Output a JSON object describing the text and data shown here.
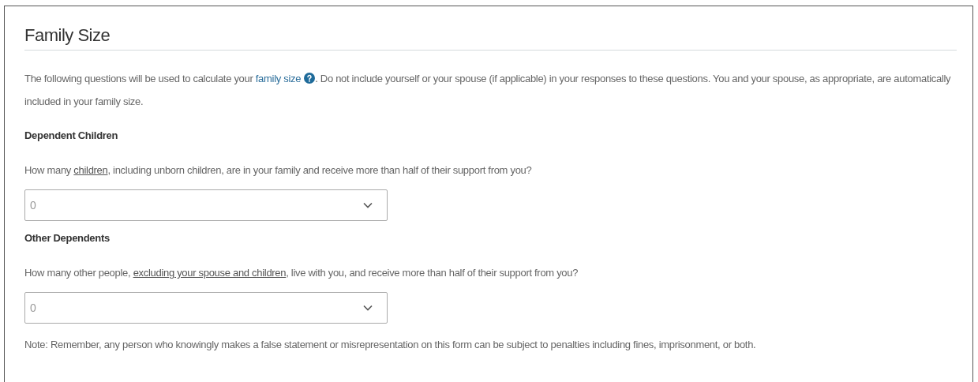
{
  "title": "Family Size",
  "intro": {
    "before": "The following questions will be used to calculate your ",
    "link": "family size",
    "after": ". Do not include yourself or your spouse (if applicable) in your responses to these questions. You and your spouse, as appropriate, are automatically included in your family size."
  },
  "sections": [
    {
      "heading": "Dependent Children",
      "question": {
        "before": "How many ",
        "link": "children",
        "after": ", including unborn children, are in your family and receive more than half of their support from you?"
      },
      "select": {
        "value": "0"
      }
    },
    {
      "heading": "Other Dependents",
      "question": {
        "before": "How many other people, ",
        "link": "excluding your spouse and children",
        "after": ", live with you, and receive more than half of their support from you?"
      },
      "select": {
        "value": "0"
      }
    }
  ],
  "note": "Note: Remember, any person who knowingly makes a false statement or misrepresentation on this form can be subject to penalties including fines, imprisonment, or both."
}
